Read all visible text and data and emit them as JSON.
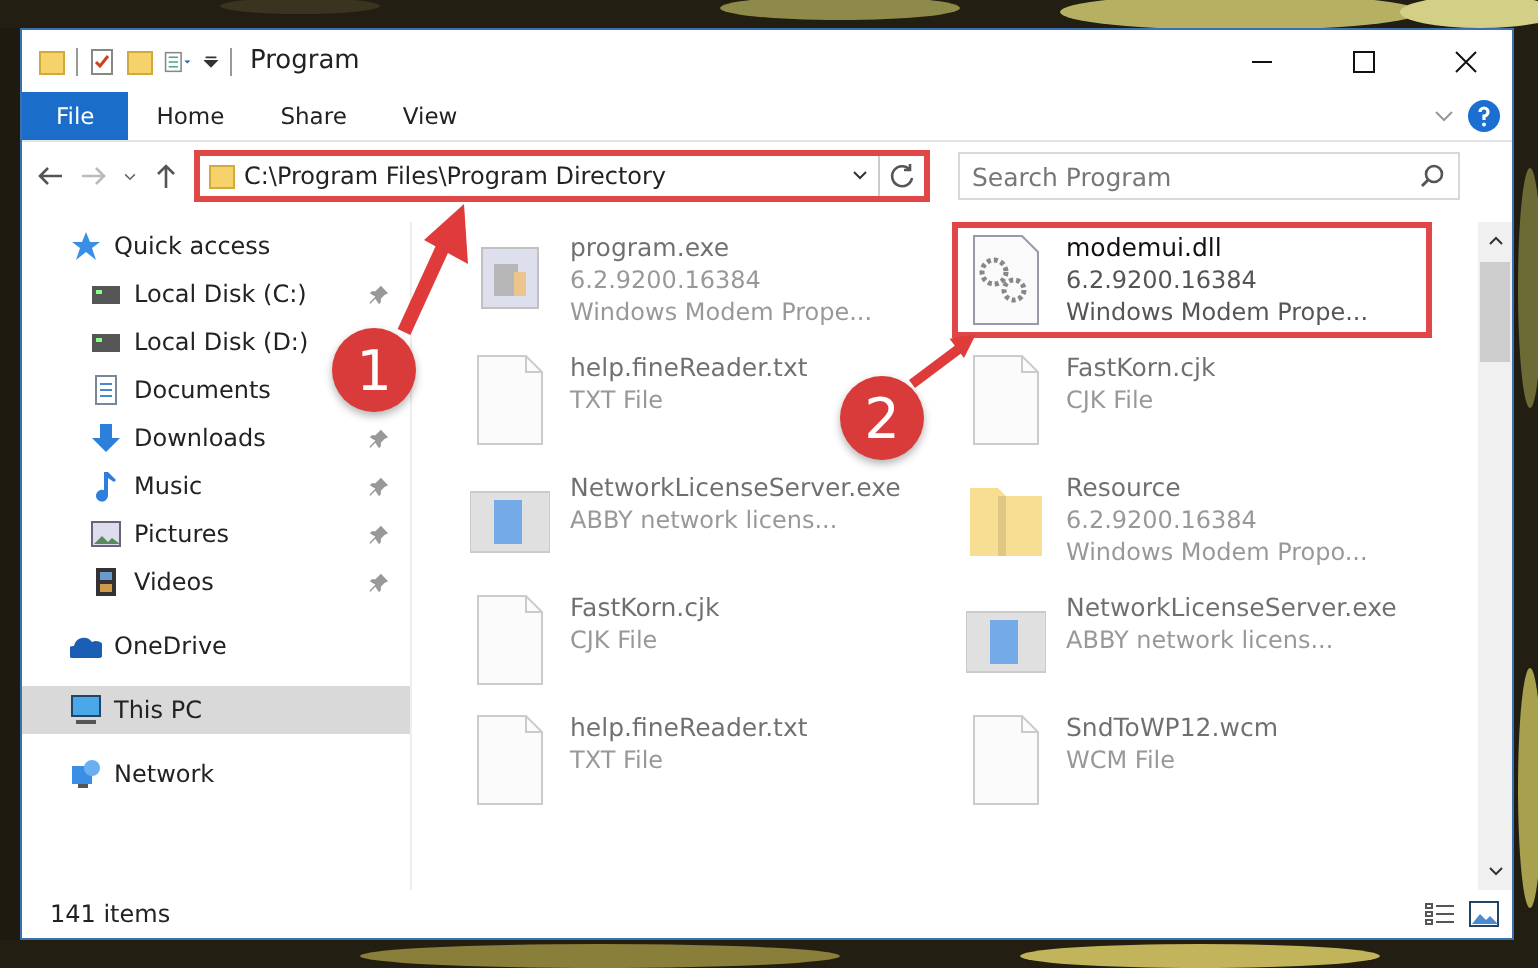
{
  "window": {
    "title": "Program"
  },
  "ribbon_tabs": [
    {
      "label": "File",
      "selected": true
    },
    {
      "label": "Home",
      "selected": false
    },
    {
      "label": "Share",
      "selected": false
    },
    {
      "label": "View",
      "selected": false
    }
  ],
  "address": {
    "value": "C:\\Program Files\\Program Directory",
    "highlighted": true
  },
  "search": {
    "placeholder": "Search Program"
  },
  "sidebar": {
    "items": [
      {
        "label": "Quick access",
        "selected": false,
        "children": [
          {
            "label": "Local Disk (C:)",
            "pinned": true,
            "selected": false
          },
          {
            "label": "Local Disk (D:)",
            "pinned": false,
            "selected": false
          },
          {
            "label": "Documents",
            "pinned": false,
            "selected": false
          },
          {
            "label": "Downloads",
            "pinned": true,
            "selected": false
          },
          {
            "label": "Music",
            "pinned": true,
            "selected": false
          },
          {
            "label": "Pictures",
            "pinned": true,
            "selected": false
          },
          {
            "label": "Videos",
            "pinned": true,
            "selected": false
          }
        ]
      },
      {
        "label": "OneDrive",
        "selected": false
      },
      {
        "label": "This PC",
        "selected": true
      },
      {
        "label": "Network",
        "selected": false
      }
    ]
  },
  "files": [
    {
      "name": "program.exe",
      "lines": [
        "6.2.9200.16384",
        "Windows Modem Prope..."
      ],
      "kind": "program",
      "dimmed": true,
      "highlighted": false
    },
    {
      "name": "modemui.dll",
      "lines": [
        "6.2.9200.16384",
        "Windows Modem Prope..."
      ],
      "kind": "library",
      "dimmed": false,
      "highlighted": true
    },
    {
      "name": "help.fineReader.txt",
      "lines": [
        "TXT File"
      ],
      "kind": "document",
      "dimmed": true,
      "highlighted": false
    },
    {
      "name": "FastKorn.cjk",
      "lines": [
        "CJK File"
      ],
      "kind": "document",
      "dimmed": true,
      "highlighted": false
    },
    {
      "name": "NetworkLicenseServer.exe",
      "lines": [
        "ABBY network licens..."
      ],
      "kind": "window",
      "dimmed": true,
      "highlighted": false
    },
    {
      "name": "Resource",
      "lines": [
        "6.2.9200.16384",
        "Windows Modem Propo..."
      ],
      "kind": "folder",
      "dimmed": true,
      "highlighted": false
    },
    {
      "name": "FastKorn.cjk",
      "lines": [
        "CJK File"
      ],
      "kind": "document",
      "dimmed": true,
      "highlighted": false
    },
    {
      "name": "NetworkLicenseServer.exe",
      "lines": [
        "ABBY network licens..."
      ],
      "kind": "window",
      "dimmed": true,
      "highlighted": false
    },
    {
      "name": "help.fineReader.txt",
      "lines": [
        "TXT File"
      ],
      "kind": "document",
      "dimmed": true,
      "highlighted": false
    },
    {
      "name": "SndToWP12.wcm",
      "lines": [
        "WCM File"
      ],
      "kind": "document",
      "dimmed": true,
      "highlighted": false
    }
  ],
  "status_bar": {
    "count": "141 items"
  },
  "annotations": [
    {
      "label": "1"
    },
    {
      "label": "2"
    }
  ]
}
